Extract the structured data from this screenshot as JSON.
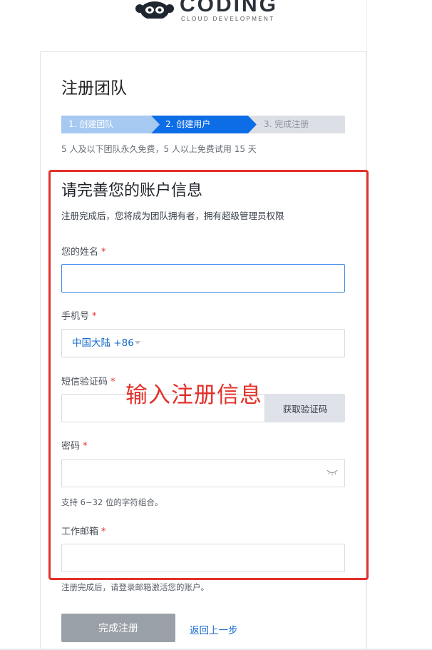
{
  "brand": {
    "name": "CODING",
    "tagline": "CLOUD DEVELOPMENT"
  },
  "page": {
    "title": "注册团队",
    "steps": [
      {
        "label": "1. 创建团队",
        "state": "done"
      },
      {
        "label": "2. 创建用户",
        "state": "active"
      },
      {
        "label": "3. 完成注册",
        "state": "pending"
      }
    ],
    "free_note": "5 人及以下团队永久免费，5 人以上免费试用 15 天"
  },
  "form": {
    "section_title": "请完善您的账户信息",
    "section_subtitle": "注册完成后，您将成为团队拥有者，拥有超级管理员权限",
    "name_label": "您的姓名",
    "name_value": "",
    "phone_label": "手机号",
    "country_value": "中国大陆 +86",
    "sms_label": "短信验证码",
    "sms_value": "",
    "sms_button": "获取验证码",
    "password_label": "密码",
    "password_value": "",
    "password_hint": "支持 6~32 位的字符组合。",
    "email_label": "工作邮箱",
    "email_value": "",
    "email_hint": "注册完成后，请登录邮箱激活您的账户。",
    "required_mark": "*",
    "submit_label": "完成注册",
    "back_label": "返回上一步"
  },
  "annotation": {
    "text": "输入注册信息",
    "color": "#e3302a"
  },
  "colors": {
    "accent": "#0d6de6",
    "step_done": "#a6c9f1",
    "step_pending": "#dcdfe5",
    "link": "#1468c9",
    "required": "#e1352c",
    "button_disabled": "#9aa0a8"
  }
}
